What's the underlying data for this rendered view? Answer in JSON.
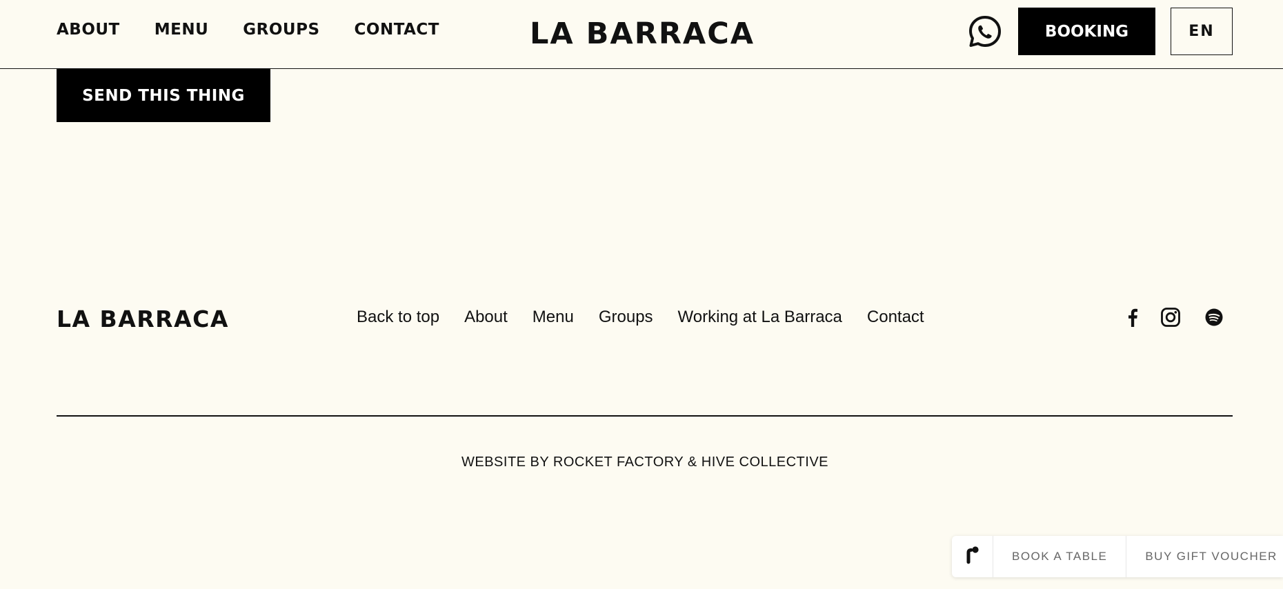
{
  "header": {
    "nav": [
      "ABOUT",
      "MENU",
      "GROUPS",
      "CONTACT"
    ],
    "logo": "LA BARRACA",
    "booking_label": "BOOKING",
    "language": "EN"
  },
  "form": {
    "submit_label": "SEND THIS THING"
  },
  "footer": {
    "logo": "LA BARRACA",
    "links": [
      "Back to top",
      "About",
      "Menu",
      "Groups",
      "Working at La Barraca",
      "Contact"
    ],
    "social_icons": [
      "facebook-icon",
      "instagram-icon",
      "spotify-icon"
    ],
    "credit": "WEBSITE BY ROCKET FACTORY & HIVE COLLECTIVE"
  },
  "booking_widget": {
    "book_label": "BOOK A TABLE",
    "voucher_label": "BUY GIFT VOUCHER"
  }
}
